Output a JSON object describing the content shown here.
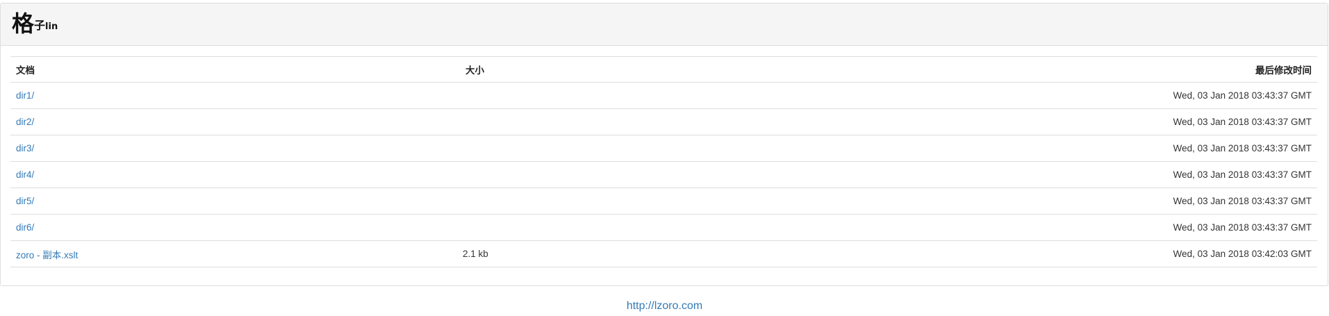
{
  "header": {
    "logo_main": "格",
    "logo_sub_a": "子",
    "logo_sub_b": "lin"
  },
  "table": {
    "columns": {
      "name": "文档",
      "size": "大小",
      "modified": "最后修改时间"
    },
    "rows": [
      {
        "name": "dir1/",
        "size": "",
        "modified": "Wed, 03 Jan 2018 03:43:37 GMT"
      },
      {
        "name": "dir2/",
        "size": "",
        "modified": "Wed, 03 Jan 2018 03:43:37 GMT"
      },
      {
        "name": "dir3/",
        "size": "",
        "modified": "Wed, 03 Jan 2018 03:43:37 GMT"
      },
      {
        "name": "dir4/",
        "size": "",
        "modified": "Wed, 03 Jan 2018 03:43:37 GMT"
      },
      {
        "name": "dir5/",
        "size": "",
        "modified": "Wed, 03 Jan 2018 03:43:37 GMT"
      },
      {
        "name": "dir6/",
        "size": "",
        "modified": "Wed, 03 Jan 2018 03:43:37 GMT"
      },
      {
        "name": "zoro - 副本.xslt",
        "size": "2.1 kb",
        "modified": "Wed, 03 Jan 2018 03:42:03 GMT"
      }
    ]
  },
  "footer": {
    "link_text": "http://lzoro.com"
  },
  "colors": {
    "link": "#337ab7",
    "heading_bg": "#f5f5f5",
    "border": "#dddddd"
  }
}
